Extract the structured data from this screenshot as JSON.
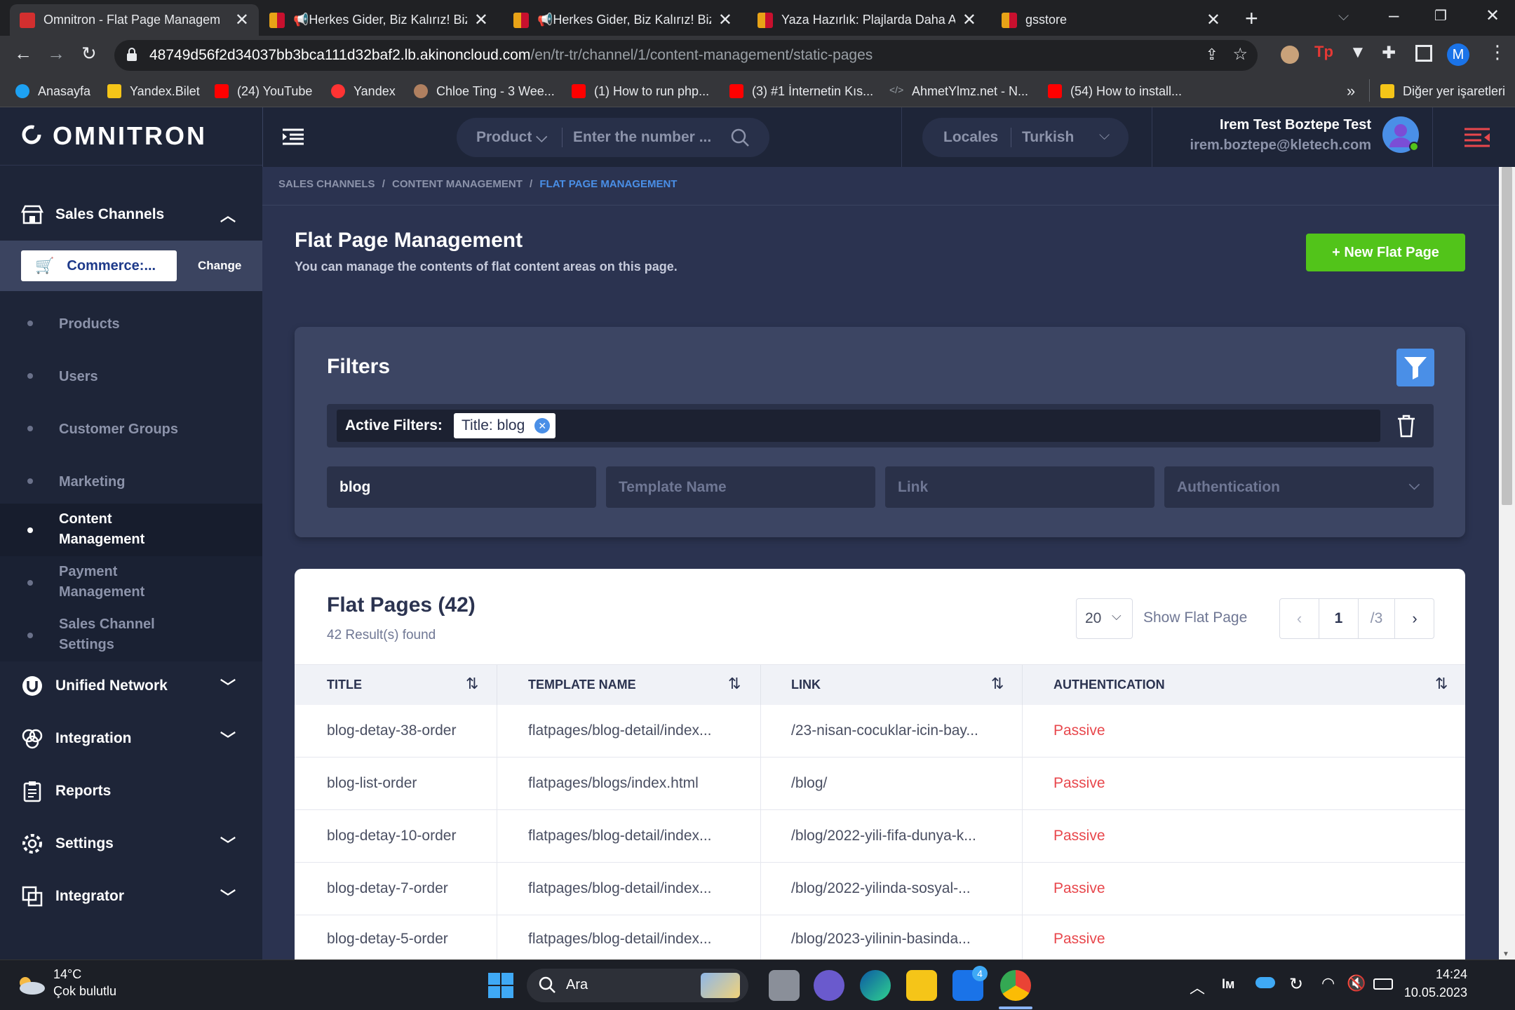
{
  "browser": {
    "tabs": [
      {
        "title": "Omnitron - Flat Page Managem",
        "favicon": "omnitron-icon",
        "color": "#d32f2f"
      },
      {
        "title": "📢Herkes Gider, Biz Kalırız! Biz",
        "favicon": "gs-icon",
        "color": "#e8a317"
      },
      {
        "title": "📢Herkes Gider, Biz Kalırız! Biz",
        "favicon": "gs-icon",
        "color": "#e8a317"
      },
      {
        "title": "Yaza Hazırlık: Plajlarda Daha Atl",
        "favicon": "gs-icon",
        "color": "#e8a317"
      },
      {
        "title": "gsstore",
        "favicon": "gs-icon",
        "color": "#e8a317"
      }
    ],
    "url_host": "48749d56f2d34037bb3bca111d32baf2.lb.akinoncloud.com",
    "url_path": "/en/tr-tr/channel/1/content-management/static-pages",
    "bookmarks": [
      {
        "label": "Anasayfa",
        "icon": "twitter-icon",
        "color": "#1da1f2"
      },
      {
        "label": "Yandex.Bilet",
        "icon": "yandex-bilet-icon",
        "color": "#f5c518"
      },
      {
        "label": "(24) YouTube",
        "icon": "youtube-icon",
        "color": "#ff0000"
      },
      {
        "label": "Yandex",
        "icon": "yandex-icon",
        "color": "#f33"
      },
      {
        "label": "Chloe Ting - 3 Wee...",
        "icon": "avatar-icon",
        "color": "#b08060"
      },
      {
        "label": "(1) How to run php...",
        "icon": "youtube-icon",
        "color": "#ff0000"
      },
      {
        "label": "(3) #1 İnternetin Kıs...",
        "icon": "youtube-icon",
        "color": "#ff0000"
      },
      {
        "label": "AhmetYlmz.net - N...",
        "icon": "code-icon",
        "color": "#9aa0a6"
      },
      {
        "label": "(54) How to install...",
        "icon": "youtube-icon",
        "color": "#ff0000"
      }
    ],
    "bookmarks_more": "»",
    "other_bookmarks": "Diğer yer işaretleri",
    "profile_initial": "M"
  },
  "app": {
    "logo": "OMNITRON",
    "product_select": "Product",
    "search_placeholder": "Enter the number ...",
    "locales_label": "Locales",
    "locale_value": "Turkish",
    "user_name": "Irem Test Boztepe Test",
    "user_email": "irem.boztepe@kletech.com"
  },
  "sidebar": {
    "sales_channels": "Sales Channels",
    "channel_name": "Commerce:...",
    "change_label": "Change",
    "sub_items": [
      "Products",
      "Users",
      "Customer Groups",
      "Marketing",
      "Content Management",
      "Payment Management",
      "Sales Channel Settings"
    ],
    "sections": [
      "Unified Network",
      "Integration",
      "Reports",
      "Settings",
      "Integrator"
    ]
  },
  "breadcrumb": {
    "items": [
      "SALES CHANNELS",
      "CONTENT MANAGEMENT",
      "FLAT PAGE MANAGEMENT"
    ],
    "separator": "/"
  },
  "page": {
    "title": "Flat Page Management",
    "subtitle": "You can manage the contents of flat content areas on this page.",
    "new_button": "+ New Flat Page"
  },
  "filters": {
    "title": "Filters",
    "active_label": "Active Filters:",
    "chip": "Title: blog",
    "title_value": "blog",
    "template_placeholder": "Template Name",
    "link_placeholder": "Link",
    "auth_placeholder": "Authentication"
  },
  "list": {
    "title": "Flat Pages (42)",
    "result_text": "42 Result(s) found",
    "page_size": "20",
    "show_label": "Show Flat Page",
    "current_page": "1",
    "total_pages": "/3",
    "columns": [
      "TITLE",
      "TEMPLATE NAME",
      "LINK",
      "AUTHENTICATION"
    ],
    "rows": [
      {
        "title": "blog-detay-38-order",
        "template": "flatpages/blog-detail/index...",
        "link": "/23-nisan-cocuklar-icin-bay...",
        "auth": "Passive"
      },
      {
        "title": "blog-list-order",
        "template": "flatpages/blogs/index.html",
        "link": "/blog/",
        "auth": "Passive"
      },
      {
        "title": "blog-detay-10-order",
        "template": "flatpages/blog-detail/index...",
        "link": "/blog/2022-yili-fifa-dunya-k...",
        "auth": "Passive"
      },
      {
        "title": "blog-detay-7-order",
        "template": "flatpages/blog-detail/index...",
        "link": "/blog/2022-yilinda-sosyal-...",
        "auth": "Passive"
      },
      {
        "title": "blog-detay-5-order",
        "template": "flatpages/blog-detail/index...",
        "link": "/blog/2023-yilinin-basinda...",
        "auth": "Passive"
      }
    ]
  },
  "taskbar": {
    "temperature": "14°C",
    "weather": "Çok bulutlu",
    "search_label": "Ara",
    "time": "14:24",
    "date": "10.05.2023",
    "mail_badge": "4"
  },
  "colors": {
    "accent": "#4a8fe7",
    "green": "#52c41a",
    "passive": "#e8474c",
    "sidebar": "#1e2538",
    "main": "#2b3350"
  }
}
